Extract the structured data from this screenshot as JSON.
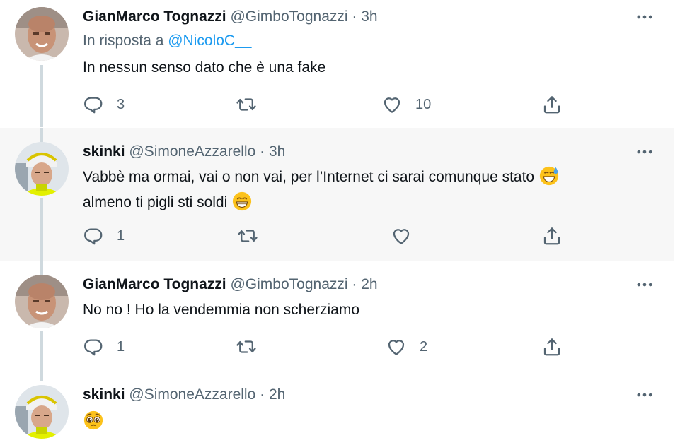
{
  "colors": {
    "link": "#1d9bf0",
    "secondary": "#536471",
    "text": "#0f1419",
    "highlight_bg": "#f7f7f7",
    "thread_line": "#cfd9de"
  },
  "tweets": [
    {
      "name": "GianMarco Tognazzi",
      "handle": "@GimboTognazzi",
      "sep": "·",
      "time": "3h",
      "reply_prefix": "In risposta a ",
      "reply_mention": "@NicoloC__",
      "text": "In nessun senso dato che è una fake",
      "replies": "3",
      "retweets": "",
      "likes": "10"
    },
    {
      "name": "skinki",
      "handle": "@SimoneAzzarello",
      "sep": "·",
      "time": "3h",
      "text_line1": "Vabbè ma ormai, vai o non vai, per l’Internet ci sarai comunque stato",
      "emoji1": "grinning-face-with-sweat",
      "text_line2": "almeno ti pigli sti soldi",
      "emoji2": "beaming-face-with-smiling-eyes",
      "replies": "1",
      "retweets": "",
      "likes": ""
    },
    {
      "name": "GianMarco Tognazzi",
      "handle": "@GimboTognazzi",
      "sep": "·",
      "time": "2h",
      "text": "No no ! Ho la vendemmia non scherziamo",
      "replies": "1",
      "retweets": "",
      "likes": "2"
    },
    {
      "name": "skinki",
      "handle": "@SimoneAzzarello",
      "sep": "·",
      "time": "2h",
      "emoji": "pleading-face"
    }
  ]
}
